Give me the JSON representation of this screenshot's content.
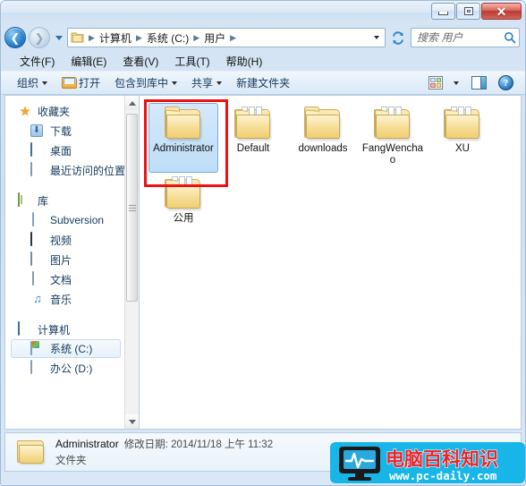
{
  "window": {
    "buttons": {
      "minimize": "—",
      "maximize": "□",
      "close": "✕"
    }
  },
  "address": {
    "back_label": "◀",
    "forward_label": "▶",
    "history_label": "▾",
    "crumbs": [
      "计算机",
      "系统 (C:)",
      "用户"
    ],
    "separator": "▶",
    "dropdown_label": "▾",
    "refresh_label": "↻"
  },
  "search": {
    "placeholder": "搜索 用户",
    "value": "",
    "icon": "search-icon"
  },
  "menubar": {
    "items": [
      {
        "label": "文件(F)"
      },
      {
        "label": "编辑(E)"
      },
      {
        "label": "查看(V)"
      },
      {
        "label": "工具(T)"
      },
      {
        "label": "帮助(H)"
      }
    ]
  },
  "toolbar": {
    "organize": "组织",
    "organize_caret": "▾",
    "open": "打开",
    "include_library": "包含到库中",
    "include_caret": "▾",
    "share": "共享",
    "share_caret": "▾",
    "new_folder": "新建文件夹",
    "views_caret": "▾",
    "help_glyph": "?"
  },
  "sidebar": {
    "favorites": {
      "header": "收藏夹",
      "items": [
        {
          "label": "下载",
          "icon": "download-icon"
        },
        {
          "label": "桌面",
          "icon": "desktop-icon"
        },
        {
          "label": "最近访问的位置",
          "icon": "recent-places-icon"
        }
      ]
    },
    "libraries": {
      "header": "库",
      "items": [
        {
          "label": "Subversion",
          "icon": "document-icon"
        },
        {
          "label": "视频",
          "icon": "video-icon"
        },
        {
          "label": "图片",
          "icon": "picture-icon"
        },
        {
          "label": "文档",
          "icon": "document-icon"
        },
        {
          "label": "音乐",
          "icon": "music-icon"
        }
      ]
    },
    "computer": {
      "header": "计算机",
      "items": [
        {
          "label": "系统 (C:)",
          "icon": "windows-drive-icon",
          "selected": true
        },
        {
          "label": "办公 (D:)",
          "icon": "drive-icon",
          "selected": false
        }
      ]
    }
  },
  "content": {
    "items": [
      {
        "label": "Administrator",
        "type": "folder-empty",
        "selected": true,
        "annotated": true
      },
      {
        "label": "Default",
        "type": "folder-files",
        "selected": false,
        "annotated": false
      },
      {
        "label": "downloads",
        "type": "folder-empty",
        "selected": false,
        "annotated": false
      },
      {
        "label": "FangWenchao",
        "type": "folder-files",
        "selected": false,
        "annotated": false
      },
      {
        "label": "XU",
        "type": "folder-files",
        "selected": false,
        "annotated": false
      },
      {
        "label": "公用",
        "type": "folder-files",
        "selected": false,
        "annotated": false
      }
    ]
  },
  "details": {
    "name": "Administrator",
    "modified": "修改日期: 2014/11/18 上午 11:32",
    "type": "文件夹"
  },
  "watermark": {
    "title": "电脑百科知识",
    "url": "www.pc-daily.com"
  },
  "colors": {
    "accent": "#1c74bd",
    "selection": "#bdddf7",
    "annotation": "#ee1111",
    "folder": "#f3d98c",
    "watermark_cyan": "#18b6e8",
    "watermark_red": "#e8232a"
  }
}
